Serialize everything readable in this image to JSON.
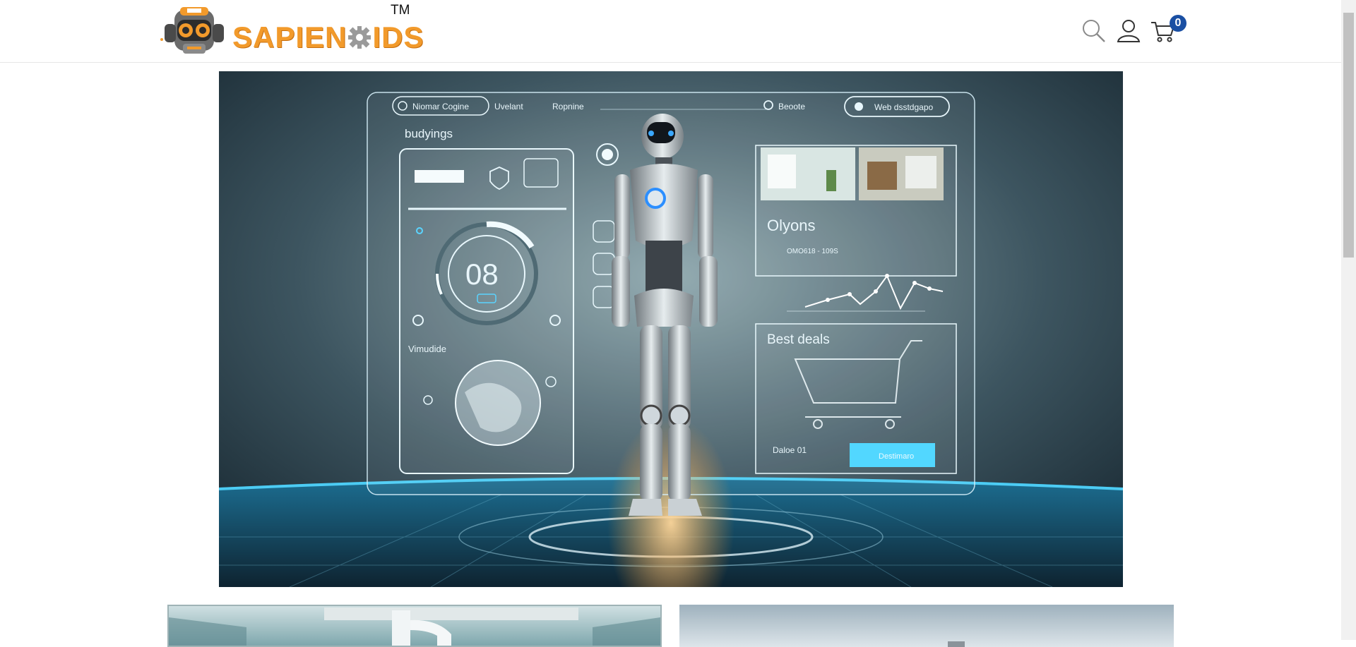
{
  "brand": {
    "name": "SAPIEN",
    "name_suffix": "IDS",
    "trademark": "TM"
  },
  "header": {
    "icons": [
      "search-icon",
      "user-icon",
      "cart-icon"
    ],
    "cart_count": "0"
  },
  "hero": {
    "nav_labels": [
      "Niomar Cogine",
      "Uvelant",
      "Ropnine"
    ],
    "search_label": "Beoote",
    "pill_label": "Web dsstdgapo",
    "panel_left_title": "budyings",
    "gauge_value": "08",
    "panel_left_footer": "Vimudide",
    "chart_title": "Olyons",
    "chart_subtitle": "OMO618 - 109S",
    "deals_title": "Best deals",
    "deals_caption": "Daloe 01",
    "deals_button": "Destimaro"
  },
  "colors": {
    "brand_orange": "#f29a2b",
    "badge_blue": "#1a4fa3",
    "hero_glow": "#52d7ff"
  }
}
